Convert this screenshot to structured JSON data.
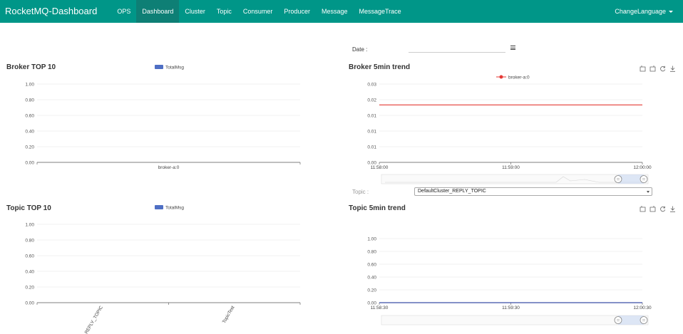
{
  "nav": {
    "brand": "RocketMQ-Dashboard",
    "items": [
      "OPS",
      "Dashboard",
      "Cluster",
      "Topic",
      "Consumer",
      "Producer",
      "Message",
      "MessageTrace"
    ],
    "active": "Dashboard",
    "change_language": "ChangeLanguage"
  },
  "date": {
    "label": "Date :",
    "value": ""
  },
  "topic_select": {
    "label": "Topic :",
    "value": "DefaultCluster_REPLY_TOPIC"
  },
  "colors": {
    "nav": "#009688",
    "nav_active": "#0e7f75",
    "bar_series": "#4f6fc4",
    "broker_trend_line": "#e53935",
    "topic_trend_line": "#3b4fa8"
  },
  "broker_top10": {
    "title": "Broker TOP 10",
    "chart_data": {
      "type": "bar",
      "legend": "TotalMsg",
      "categories": [
        "broker-a:0"
      ],
      "values": [
        0
      ],
      "ylim": [
        0,
        1
      ],
      "yticks": [
        "1.00",
        "0.80",
        "0.60",
        "0.40",
        "0.20",
        "0.00"
      ]
    }
  },
  "broker_trend": {
    "title": "Broker 5min trend",
    "chart_data": {
      "type": "line",
      "legend": "broker-a:0",
      "x": [
        "11:58:00",
        "11:59:00",
        "12:00:00"
      ],
      "y": [
        0.022,
        0.022,
        0.022
      ],
      "yticks": [
        "0.03",
        "0.02",
        "0.01",
        "0.01",
        "0.01",
        "0.00"
      ]
    }
  },
  "topic_top10": {
    "title": "Topic TOP 10",
    "chart_data": {
      "type": "bar",
      "legend": "TotalMsg",
      "categories": [
        "REPLY_TOPIC",
        "TopicTest"
      ],
      "values": [
        0,
        0
      ],
      "ylim": [
        0,
        1
      ],
      "yticks": [
        "1.00",
        "0.80",
        "0.60",
        "0.40",
        "0.20",
        "0.00"
      ]
    }
  },
  "topic_trend": {
    "title": "Topic 5min trend",
    "chart_data": {
      "type": "line",
      "x": [
        "11:58:30",
        "11:59:30",
        "12:00:30"
      ],
      "y": [
        0,
        0,
        0
      ],
      "ylim": [
        0,
        1
      ],
      "yticks": [
        "1.00",
        "0.80",
        "0.60",
        "0.40",
        "0.20",
        "0.00"
      ]
    }
  },
  "toolbox_icons": [
    "zoom-icon",
    "zoom-reset-icon",
    "restore-icon",
    "save-image-icon"
  ]
}
